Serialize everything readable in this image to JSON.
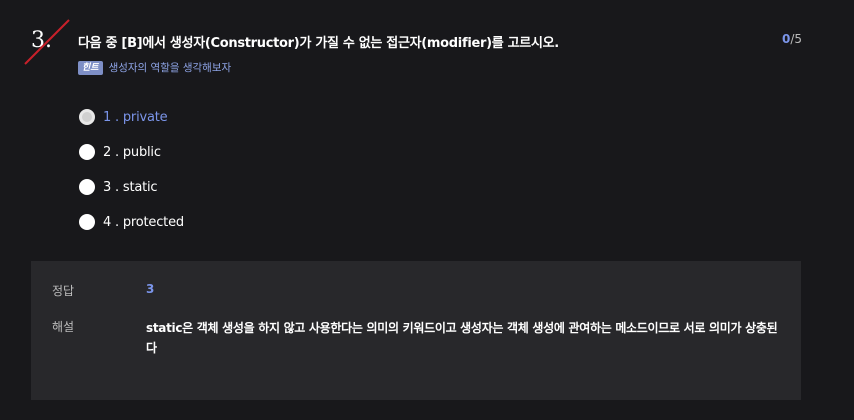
{
  "question": {
    "number": "3.",
    "title": "다음 중 [B]에서 생성자(Constructor)가 가질 수 없는 접근자(modifier)를 고르시오.",
    "hint_badge": "힌트",
    "hint_text": "생성자의 역할을 생각해보자"
  },
  "score": {
    "got": "0",
    "separator": "/",
    "total": "5"
  },
  "options": [
    {
      "label": "1 . private",
      "selected": true
    },
    {
      "label": "2 . public",
      "selected": false
    },
    {
      "label": "3 . static",
      "selected": false
    },
    {
      "label": "4 . protected",
      "selected": false
    }
  ],
  "answer": {
    "answer_key_label": "정답",
    "answer_value": "3",
    "explain_key_label": "해설",
    "explain_value": "static은 객체 생성을 하지 않고 사용한다는 의미의 키워드이고 생성자는 객체 생성에 관여하는 메소드이므로 서로 의미가 상충된다"
  },
  "colors": {
    "background": "#18181b",
    "accent": "#7b95ea",
    "strike": "#c8202a",
    "panel": "#28282b"
  }
}
